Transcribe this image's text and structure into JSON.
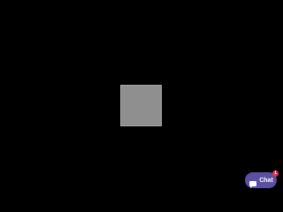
{
  "canvas": {
    "background": "#000000"
  },
  "placeholder": {
    "fill": "#8f8f8f"
  },
  "chat_widget": {
    "label": "Chat",
    "icon": "chat-bubble-icon",
    "badge_count": "1",
    "accent": "#5b4fa1",
    "badge_color": "#e2324f"
  }
}
